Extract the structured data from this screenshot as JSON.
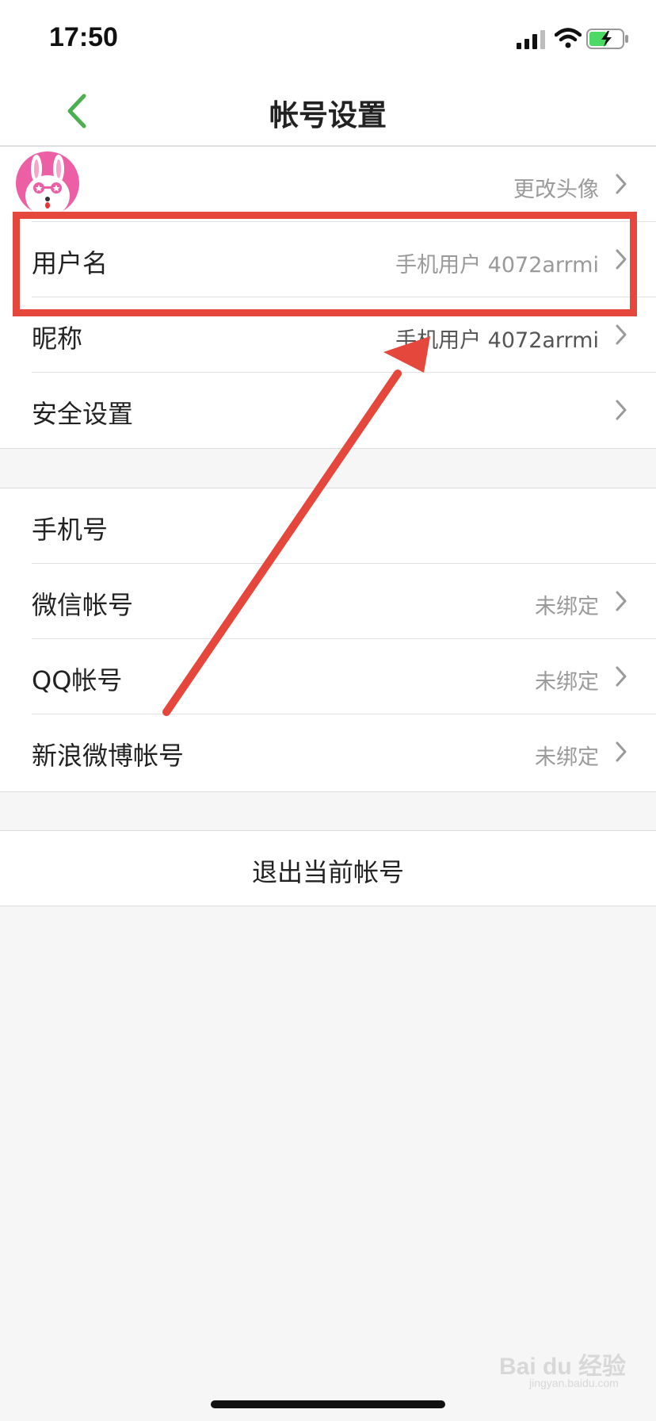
{
  "status_bar": {
    "time": "17:50"
  },
  "nav": {
    "title": "帐号设置",
    "back_icon": "chevron-left-icon",
    "accent": "#4caf50"
  },
  "profile": {
    "avatar_row": {
      "value": "更改头像"
    },
    "rows": [
      {
        "label": "用户名",
        "value": "手机用户 4072arrmi"
      },
      {
        "label": "昵称",
        "value": "手机用户 4072arrmi"
      },
      {
        "label": "安全设置",
        "value": ""
      }
    ]
  },
  "bindings": {
    "rows": [
      {
        "label": "手机号",
        "value": ""
      },
      {
        "label": "微信帐号",
        "value": "未绑定"
      },
      {
        "label": "QQ帐号",
        "value": "未绑定"
      },
      {
        "label": "新浪微博帐号",
        "value": "未绑定"
      }
    ]
  },
  "logout": {
    "label": "退出当前帐号"
  },
  "annotation": {
    "color": "#e5473c"
  },
  "watermark": {
    "text": "Bai du 经验",
    "sub": "jingyan.baidu.com"
  }
}
